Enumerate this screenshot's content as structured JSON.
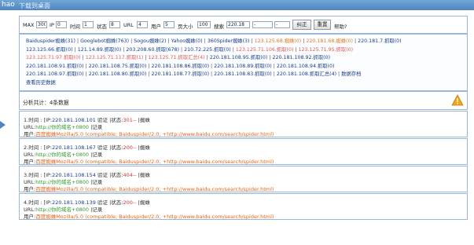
{
  "header": {
    "brand": "hao",
    "back_text": "下载到桌面"
  },
  "filter": {
    "max_label": "MAX",
    "max_value": "300",
    "ip_label": "IP",
    "ip_value": "0",
    "time_label": "时间",
    "time_value": "1",
    "status_label": "状态",
    "status_value": "8",
    "url_label": "URL",
    "url_value": "4",
    "user_label": "用户",
    "user_value": "5",
    "pagesize_label": "页大小",
    "pagesize_value": "100",
    "search_label": "搜索",
    "search_value": "220.18",
    "select_a": "-",
    "select_b": "-",
    "btn_confirm": "纠正",
    "btn_reset": "重置",
    "help": "帮助?"
  },
  "links": {
    "rows": [
      [
        {
          "t": "Baiduspider蜘蛛(31)",
          "c": ""
        },
        {
          "t": "Googlebot蜘蛛(763)",
          "c": ""
        },
        {
          "t": "Sogou蜘蛛(2)",
          "c": ""
        },
        {
          "t": "Yahoo蜘蛛(0)",
          "c": ""
        },
        {
          "t": "360Spider蜘蛛(3)",
          "c": ""
        },
        {
          "t": "123.125.68.蜘蛛(0)",
          "c": "o"
        },
        {
          "t": "220.181.68.蜘蛛(0)",
          "c": "o"
        },
        {
          "t": "220.181.7.抓取(0)",
          "c": ""
        }
      ],
      [
        {
          "t": "123.125.66.抓取(0)",
          "c": ""
        },
        {
          "t": "121.14.89.抓取(0)",
          "c": ""
        },
        {
          "t": "203.208.60.抓取(678)",
          "c": ""
        },
        {
          "t": "210.72.225.抓取(0)",
          "c": ""
        },
        {
          "t": "123.125.71.106.抓取(0)",
          "c": "r"
        },
        {
          "t": "123.125.71.95.抓取(0)",
          "c": "r"
        }
      ],
      [
        {
          "t": "123.125.71.97.抓取(0)",
          "c": "r"
        },
        {
          "t": "123.125.71.117.抓取(1)",
          "c": "r"
        },
        {
          "t": "123.125.71.抓取汇总(4)",
          "c": "r"
        },
        {
          "t": "220.181.108.95.抓取(0)",
          "c": ""
        },
        {
          "t": "220.181.108.92.抓取(0)",
          "c": ""
        }
      ],
      [
        {
          "t": "220.181.108.91.抓取(0)",
          "c": ""
        },
        {
          "t": "220.181.108.75.抓取(0)",
          "c": ""
        },
        {
          "t": "220.181.108.86.抓取(0)",
          "c": ""
        },
        {
          "t": "220.181.108.89.抓取(0)",
          "c": ""
        },
        {
          "t": "220.181.108.94.抓取(0)",
          "c": ""
        }
      ],
      [
        {
          "t": "220.181.108.97.抓取(0)",
          "c": ""
        },
        {
          "t": "220.181.108.80.抓取(0)",
          "c": ""
        },
        {
          "t": "220.181.108.77.抓取(0)",
          "c": ""
        },
        {
          "t": "220.181.108.83.抓取(0)",
          "c": ""
        },
        {
          "t": "220.181.108.抓取汇总(4)",
          "c": ""
        },
        {
          "t": "数据存档",
          "c": ""
        }
      ],
      [
        {
          "t": "查看历史数据",
          "c": ""
        }
      ]
    ]
  },
  "analysis": {
    "title": "分析共计：4条数据"
  },
  "records": [
    {
      "no": "1.时间",
      "ip_prefix": "[IP:",
      "ip": "220.181.108.101",
      "verify": "验证",
      "status_prefix": "|状态:",
      "status": "301--",
      "tail": "|蜘蛛",
      "url_label": "URL:",
      "url": "http://你的域名+0800",
      "url_tail": "|记录",
      "user_label": "用户:",
      "ua": "百度蜘蛛Mozilla/5.0 (compatible; Baiduspider/2.0; +http://www.baidu.com/search/spider.html)"
    },
    {
      "no": "2.时间",
      "ip_prefix": "[IP:",
      "ip": "220.181.108.167",
      "verify": "验证",
      "status_prefix": "|状态:",
      "status": "200--",
      "tail": "|蜘蛛",
      "url_label": "URL:",
      "url": "http://你的域名+0800",
      "url_tail": "|记录",
      "user_label": "用户:",
      "ua": "百度蜘蛛Mozilla/5.0 (compatible; Baiduspider/2.0; +http://www.baidu.com/search/spider.html)"
    },
    {
      "no": "3.时间",
      "ip_prefix": "[IP:",
      "ip": "220.181.108.154",
      "verify": "验证",
      "status_prefix": "|状态:",
      "status": "404--",
      "tail": "|蜘蛛",
      "url_label": "URL:",
      "url": "http://你的域名+0800",
      "url_tail": "|记录",
      "user_label": "用户:",
      "ua": "百度蜘蛛Mozilla/5.0 (compatible; Baiduspider/2.0; +http://www.baidu.com/search/spider.html)"
    },
    {
      "no": "4.时间",
      "ip_prefix": "[IP:",
      "ip": "220.181.108.139",
      "verify": "验证",
      "status_prefix": "|状态:",
      "status": "200--",
      "tail": "|蜘蛛",
      "url_label": "URL:",
      "url": "http://你的域名+0800",
      "url_tail": "|记录",
      "user_label": "用户:",
      "ua": "百度蜘蛛Mozilla/5.0 (compatible; Baiduspider/2.0; +http://www.baidu.com/search/spider.html)"
    }
  ],
  "colors": {
    "accent": "#4d86c0",
    "link": "#1a3d8c",
    "orange": "#e07b22",
    "red": "#e03333",
    "green": "#2e9b2e"
  }
}
